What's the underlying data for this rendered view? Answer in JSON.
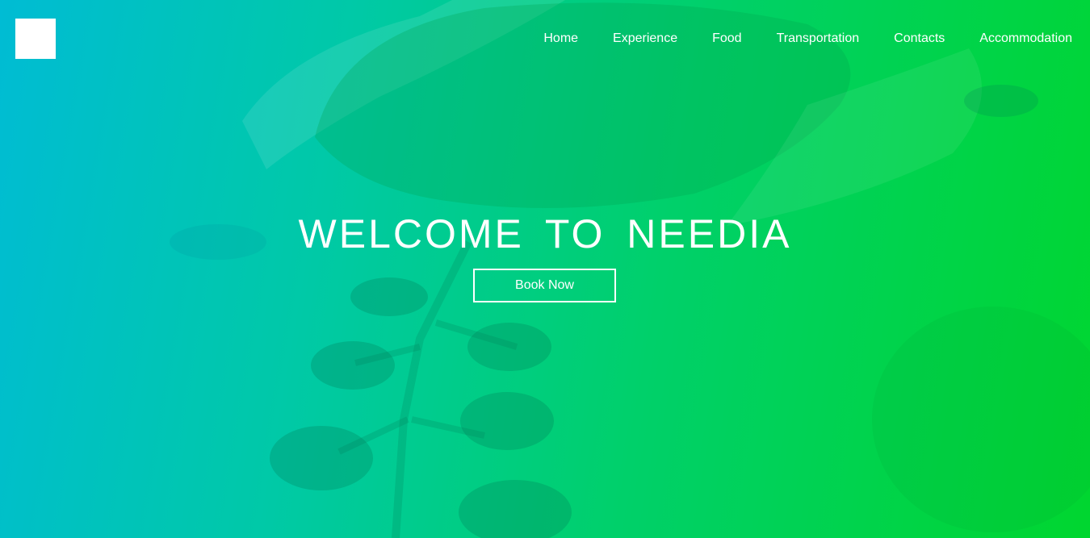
{
  "brand": {
    "logo_color": "#ffffff"
  },
  "nav": {
    "items": [
      {
        "label": "Home"
      },
      {
        "label": "Experience"
      },
      {
        "label": "Food"
      },
      {
        "label": "Transportation"
      },
      {
        "label": "Contacts"
      },
      {
        "label": "Accommodation"
      }
    ]
  },
  "hero": {
    "headline": "WELCOME TO NEEDIA",
    "cta_label": "Book Now",
    "gradient_start": "#00bcd4",
    "gradient_end": "#00d62f"
  }
}
